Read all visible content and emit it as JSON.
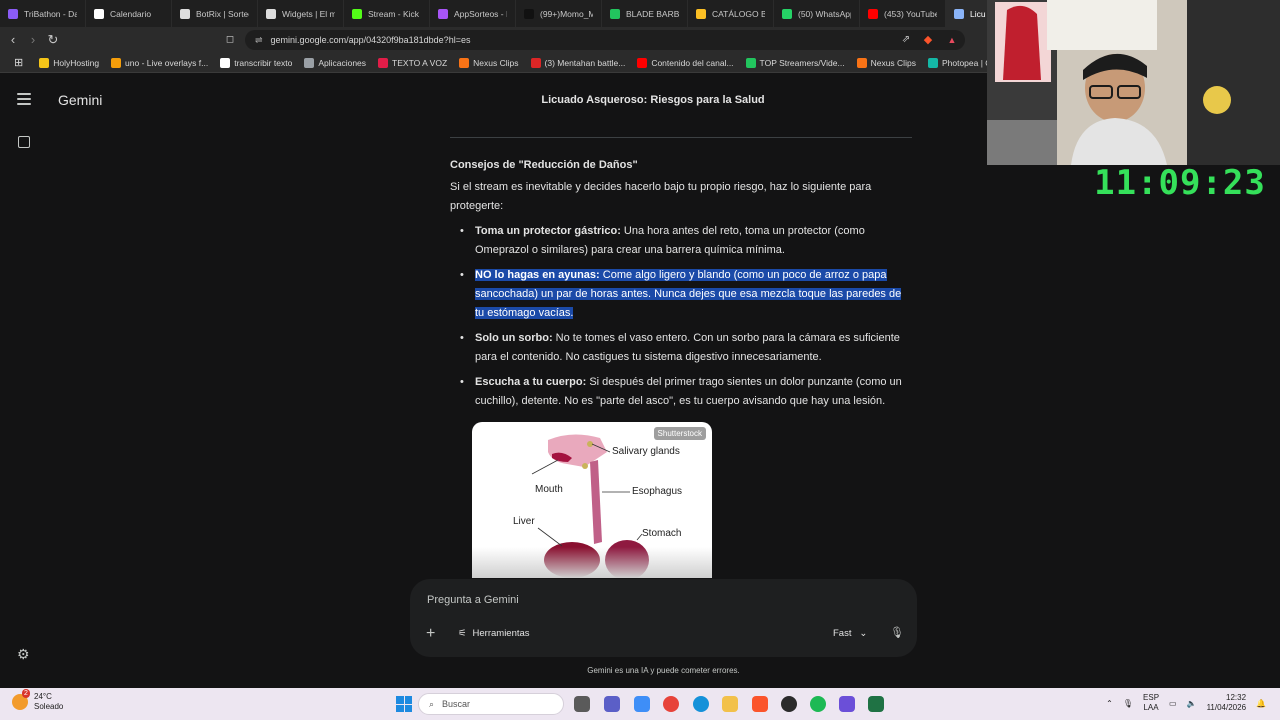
{
  "browser": {
    "tabs": [
      {
        "label": "TriBathon - Da",
        "color": "#8b5cf6"
      },
      {
        "label": "Calendario",
        "color": "#ffffff"
      },
      {
        "label": "BotRix | Sorteo",
        "color": "#dddddd"
      },
      {
        "label": "Widgets | El m",
        "color": "#dddddd"
      },
      {
        "label": "Stream - Kick D",
        "color": "#53fc18"
      },
      {
        "label": "AppSorteos - I",
        "color": "#a855f7"
      },
      {
        "label": "(99+)Momo_M",
        "color": "#111111"
      },
      {
        "label": "BLADE BARBE",
        "color": "#22c55e"
      },
      {
        "label": "CATÁLOGO BL",
        "color": "#fbbf24"
      },
      {
        "label": "(50) WhatsApp",
        "color": "#25d366"
      },
      {
        "label": "(453) YouTube",
        "color": "#ff0000"
      },
      {
        "label": "Licu",
        "color": "#8ab4f8",
        "active": true
      }
    ],
    "url": "gemini.google.com/app/04320f9ba181dbde?hl=es",
    "bookmarks": [
      {
        "label": "HolyHosting",
        "color": "#f5c518"
      },
      {
        "label": "uno - Live overlays f...",
        "color": "#f59e0b"
      },
      {
        "label": "transcribir texto",
        "color": "#ffffff"
      },
      {
        "label": "Aplicaciones",
        "color": "#9aa0a6"
      },
      {
        "label": "TEXTO A VOZ",
        "color": "#e11d48"
      },
      {
        "label": "Nexus Clips",
        "color": "#f97316"
      },
      {
        "label": "(3) Mentahan battle...",
        "color": "#dc2626"
      },
      {
        "label": "Contenido del canal...",
        "color": "#ff0000"
      },
      {
        "label": "TOP Streamers/Vide...",
        "color": "#22c55e"
      },
      {
        "label": "Nexus Clips",
        "color": "#f97316"
      },
      {
        "label": "Photopea | Online P...",
        "color": "#14b8a6"
      }
    ]
  },
  "gemini": {
    "brand": "Gemini",
    "chat_title": "Licuado Asqueroso: Riesgos para la Salud",
    "section_title": "Consejos de \"Reducción de Daños\"",
    "intro": "Si el stream es inevitable y decides hacerlo bajo tu propio riesgo, haz lo siguiente para protegerte:",
    "tips": [
      {
        "bold": "Toma un protector gástrico:",
        "text": " Una hora antes del reto, toma un protector (como Omeprazol o similares) para crear una barrera química mínima.",
        "highlighted": false
      },
      {
        "bold": "NO lo hagas en ayunas:",
        "text": " Come algo ligero y blando (como un poco de arroz o papa sancochada) un par de horas antes. Nunca dejes que esa mezcla toque las paredes de tu estómago vacías.",
        "highlighted": true
      },
      {
        "bold": "Solo un sorbo:",
        "text": " No te tomes el vaso entero. Con un sorbo para la cámara es suficiente para el contenido. No castigues tu sistema digestivo innecesariamente.",
        "highlighted": false
      },
      {
        "bold": "Escucha a tu cuerpo:",
        "text": " Si después del primer trago sientes un dolor punzante (como un cuchillo), detente. No es \"parte del asco\", es tu cuerpo avisando que hay una lesión.",
        "highlighted": false
      }
    ],
    "diagram": {
      "watermark": "Shutterstock",
      "labels": {
        "salivary": "Salivary glands",
        "mouth": "Mouth",
        "esophagus": "Esophagus",
        "liver": "Liver",
        "stomach": "Stomach"
      }
    },
    "prompt_placeholder": "Pregunta a Gemini",
    "tools_label": "Herramientas",
    "mode_label": "Fast",
    "disclaimer": "Gemini es una IA y puede cometer errores."
  },
  "overlay": {
    "clock": "11:09:23"
  },
  "taskbar": {
    "weather_temp": "24°C",
    "weather_desc": "Soleado",
    "weather_badge": "2",
    "search_placeholder": "Buscar",
    "lang_top": "ESP",
    "lang_bottom": "LAA",
    "time": "12:32",
    "date": "11/04/2026"
  }
}
